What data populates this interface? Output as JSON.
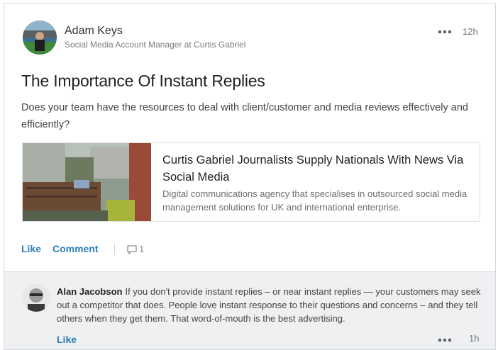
{
  "post": {
    "author_name": "Adam Keys",
    "author_headline": "Social Media Account Manager at Curtis Gabriel",
    "timestamp": "12h",
    "title": "The Importance Of Instant Replies",
    "body": "Does your team have the resources to deal with client/customer and media reviews effectively and efficiently?",
    "link_preview": {
      "title": "Curtis Gabriel Journalists Supply Nationals With News Via Social Media",
      "description": "Digital communications agency that specialises in outsourced social media management solutions for UK and international enterprise."
    },
    "actions": {
      "like_label": "Like",
      "comment_label": "Comment",
      "comment_count": "1"
    }
  },
  "comment": {
    "author_name": "Alan Jacobson",
    "text": "If you don't provide instant replies – or near instant replies — your customers may seek out a competitor that does. People love instant response to their questions and concerns – and they tell others when they get them. That word-of-mouth is the best advertising.",
    "like_label": "Like",
    "timestamp": "1h"
  },
  "colors": {
    "link_blue": "#2f7fba",
    "comment_bg": "#eef0f2"
  },
  "icons": {
    "more": "more-dots-icon",
    "comment": "comment-bubble-icon"
  }
}
